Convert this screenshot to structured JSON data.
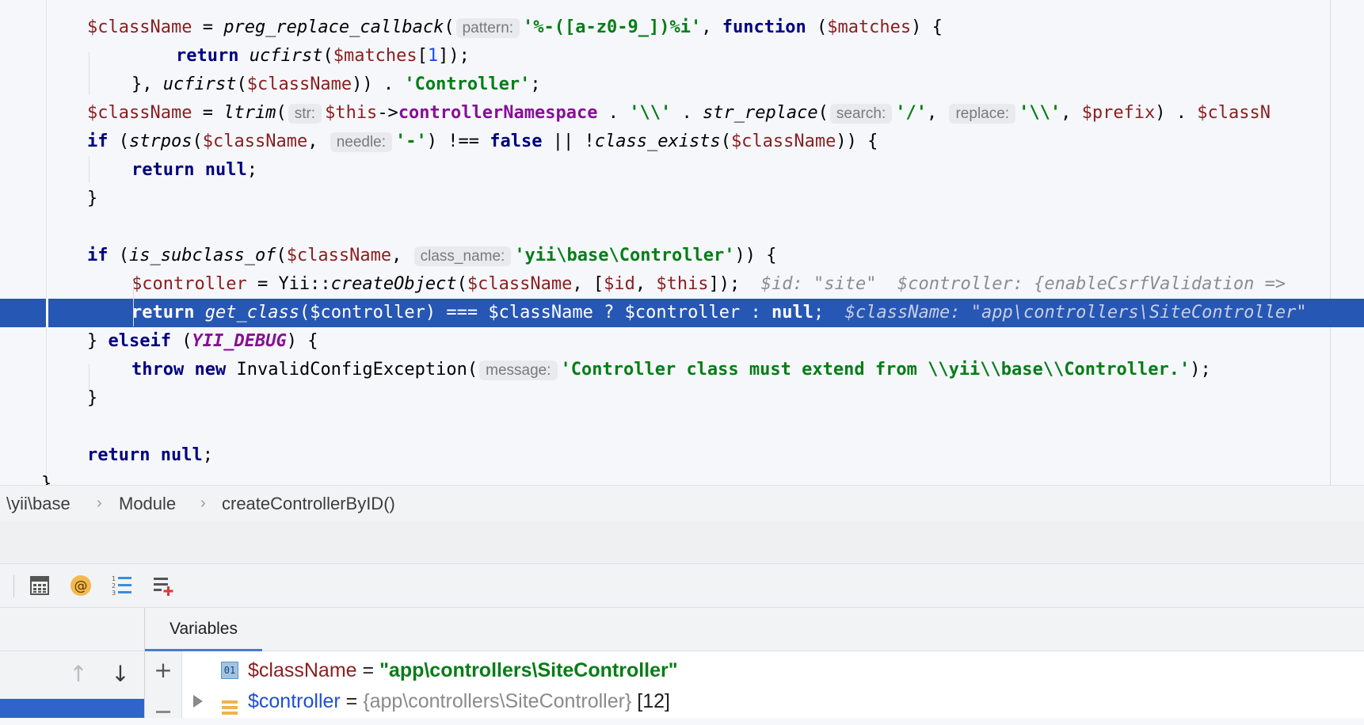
{
  "code": {
    "lines": [
      [
        {
          "t": "$className",
          "c": "var"
        },
        {
          "t": " = "
        },
        {
          "t": "preg_replace_callback",
          "c": "fn"
        },
        {
          "t": "("
        },
        {
          "h": "pattern:"
        },
        {
          "t": "'%-(",
          "c": "str"
        },
        {
          "t": "[a-z0-9_]",
          "c": "str"
        },
        {
          "t": ")%i'",
          "c": "str"
        },
        {
          "t": ", "
        },
        {
          "t": "function",
          "c": "kw"
        },
        {
          "t": " ("
        },
        {
          "t": "$matches",
          "c": "var"
        },
        {
          "t": ") {"
        }
      ],
      [
        {
          "t": "return",
          "c": "kw"
        },
        {
          "t": " "
        },
        {
          "t": "ucfirst",
          "c": "fn"
        },
        {
          "t": "("
        },
        {
          "t": "$matches",
          "c": "var"
        },
        {
          "t": "["
        },
        {
          "t": "1",
          "c": "num"
        },
        {
          "t": "]);"
        }
      ],
      [
        {
          "t": "}, "
        },
        {
          "t": "ucfirst",
          "c": "fn"
        },
        {
          "t": "("
        },
        {
          "t": "$className",
          "c": "var"
        },
        {
          "t": ")) . "
        },
        {
          "t": "'Controller'",
          "c": "str"
        },
        {
          "t": ";"
        }
      ],
      [
        {
          "t": "$className",
          "c": "var"
        },
        {
          "t": " = "
        },
        {
          "t": "ltrim",
          "c": "fn"
        },
        {
          "t": "("
        },
        {
          "h": "str:"
        },
        {
          "t": "$this",
          "c": "var"
        },
        {
          "t": "->"
        },
        {
          "t": "controllerNamespace",
          "c": "prop"
        },
        {
          "t": " . "
        },
        {
          "t": "'\\\\'",
          "c": "str"
        },
        {
          "t": " . "
        },
        {
          "t": "str_replace",
          "c": "fn"
        },
        {
          "t": "("
        },
        {
          "h": "search:"
        },
        {
          "t": "'/'",
          "c": "str"
        },
        {
          "t": ", "
        },
        {
          "h": "replace:"
        },
        {
          "t": "'\\\\'",
          "c": "str"
        },
        {
          "t": ", "
        },
        {
          "t": "$prefix",
          "c": "var"
        },
        {
          "t": ") . "
        },
        {
          "t": "$classN",
          "c": "var"
        }
      ],
      [
        {
          "t": "if",
          "c": "kw"
        },
        {
          "t": " ("
        },
        {
          "t": "strpos",
          "c": "fn"
        },
        {
          "t": "("
        },
        {
          "t": "$className",
          "c": "var"
        },
        {
          "t": ", "
        },
        {
          "h": "needle:"
        },
        {
          "t": "'-'",
          "c": "str"
        },
        {
          "t": ") !== "
        },
        {
          "t": "false",
          "c": "kw"
        },
        {
          "t": " || !"
        },
        {
          "t": "class_exists",
          "c": "fn"
        },
        {
          "t": "("
        },
        {
          "t": "$className",
          "c": "var"
        },
        {
          "t": ")) {"
        }
      ],
      [
        {
          "t": "return",
          "c": "kw"
        },
        {
          "t": " "
        },
        {
          "t": "null",
          "c": "kw"
        },
        {
          "t": ";"
        }
      ],
      [
        {
          "t": "}"
        }
      ],
      [],
      [
        {
          "t": "if",
          "c": "kw"
        },
        {
          "t": " ("
        },
        {
          "t": "is_subclass_of",
          "c": "fn"
        },
        {
          "t": "("
        },
        {
          "t": "$className",
          "c": "var"
        },
        {
          "t": ", "
        },
        {
          "h": "class_name:"
        },
        {
          "t": "'yii\\base\\Controller'",
          "c": "str"
        },
        {
          "t": ")) {"
        }
      ],
      [
        {
          "t": "$controller",
          "c": "var"
        },
        {
          "t": " = Yii::"
        },
        {
          "t": "createObject",
          "c": "fn"
        },
        {
          "t": "("
        },
        {
          "t": "$className",
          "c": "var"
        },
        {
          "t": ", ["
        },
        {
          "t": "$id",
          "c": "var"
        },
        {
          "t": ", "
        },
        {
          "t": "$this",
          "c": "var"
        },
        {
          "t": "]);  "
        },
        {
          "t": "$id: \"site\"  $controller: {enableCsrfValidation =>",
          "c": "inline"
        }
      ],
      [
        {
          "t": "return",
          "c": "kw"
        },
        {
          "t": " "
        },
        {
          "t": "get_class",
          "c": "fn"
        },
        {
          "t": "("
        },
        {
          "t": "$controller",
          "c": "var"
        },
        {
          "t": ") === "
        },
        {
          "t": "$className",
          "c": "var"
        },
        {
          "t": " ? "
        },
        {
          "t": "$controller",
          "c": "var"
        },
        {
          "t": " : "
        },
        {
          "t": "null",
          "c": "kw"
        },
        {
          "t": ";  "
        },
        {
          "t": "$className: \"app\\controllers\\SiteController\"",
          "c": "inline"
        }
      ],
      [
        {
          "t": "} "
        },
        {
          "t": "elseif",
          "c": "kw"
        },
        {
          "t": " ("
        },
        {
          "t": "YII_DEBUG",
          "c": "const"
        },
        {
          "t": ") {"
        }
      ],
      [
        {
          "t": "throw",
          "c": "kw"
        },
        {
          "t": " "
        },
        {
          "t": "new",
          "c": "kw"
        },
        {
          "t": " InvalidConfigException("
        },
        {
          "h": "message:"
        },
        {
          "t": "'Controller class must extend from \\\\yii\\\\base\\\\Controller.'",
          "c": "str"
        },
        {
          "t": ");"
        }
      ],
      [
        {
          "t": "}"
        }
      ],
      [],
      [
        {
          "t": "return",
          "c": "kw"
        },
        {
          "t": " "
        },
        {
          "t": "null",
          "c": "kw"
        },
        {
          "t": ";"
        }
      ],
      [
        {
          "t": "}"
        }
      ]
    ]
  },
  "breadcrumb": {
    "namespace": "\\yii\\base",
    "class": "Module",
    "method": "createControllerByID()",
    "separator": "›"
  },
  "debug_toolbar": {
    "icons": [
      "calculator-icon",
      "at-icon",
      "numbered-list-icon",
      "add-watch-icon"
    ]
  },
  "frames": {
    "up_arrow": "↑",
    "down_arrow": "↓"
  },
  "variables": {
    "tab_label": "Variables",
    "add_label": "+",
    "items": [
      {
        "name": "$className",
        "eq": " = ",
        "value": "\"app\\controllers\\SiteController\"",
        "type_badge": "01"
      },
      {
        "name": "$controller",
        "eq": " = ",
        "value": "{app\\controllers\\SiteController}",
        "count": " [12]"
      }
    ]
  },
  "colors": {
    "execution_line": "#2757b4",
    "string": "#067d17",
    "keyword": "#000080",
    "variable": "#8b1e1e"
  }
}
